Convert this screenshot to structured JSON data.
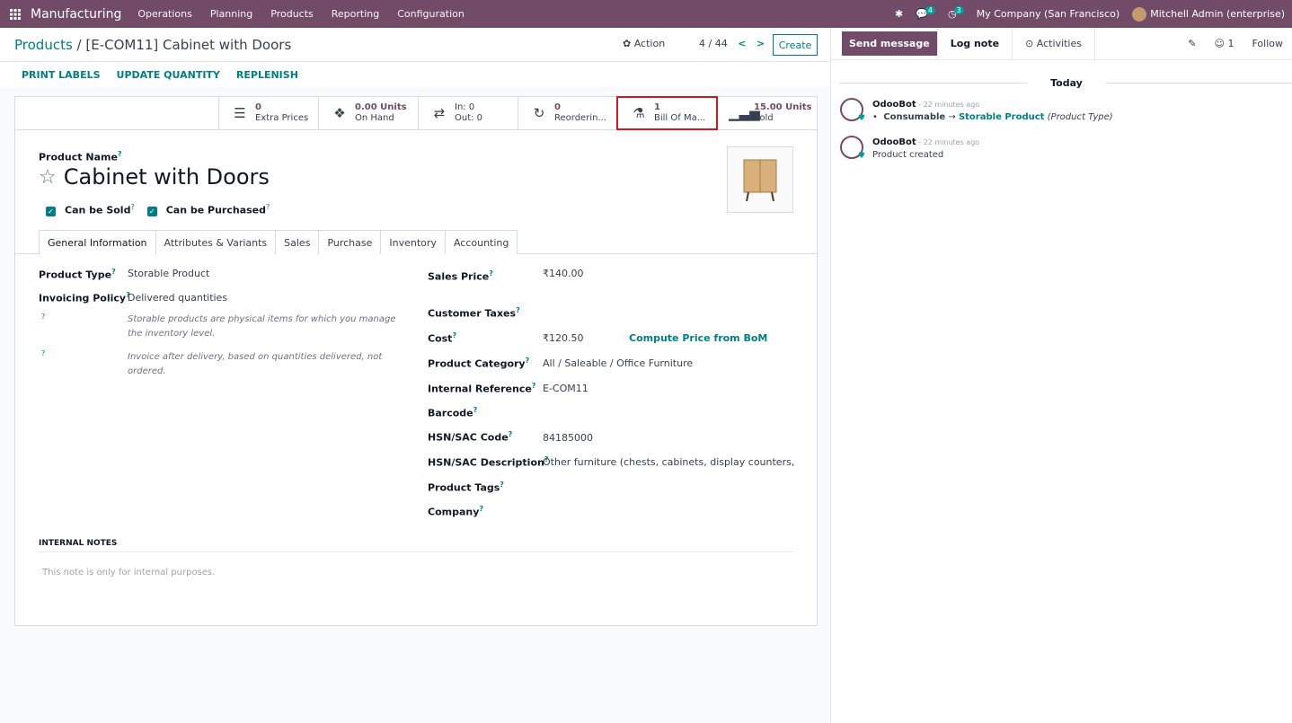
{
  "topbar": {
    "app_name": "Manufacturing",
    "menus": [
      "Operations",
      "Planning",
      "Products",
      "Reporting",
      "Configuration"
    ],
    "messages_count": "4",
    "activities_count": "3",
    "company": "My Company (San Francisco)",
    "user": "Mitchell Admin (enterprise)"
  },
  "breadcrumb": {
    "parent": "Products",
    "sep": " / ",
    "current": "[E-COM11] Cabinet with Doors"
  },
  "controlbar": {
    "action_label": "✿ Action",
    "pager": "4 / 44",
    "create_label": "Create"
  },
  "statusbar": {
    "buttons": [
      "PRINT LABELS",
      "UPDATE QUANTITY",
      "REPLENISH"
    ]
  },
  "stats": [
    {
      "num": "0",
      "label": "Extra Prices",
      "icon": "list-icon"
    },
    {
      "num": "0.00 Units",
      "label": "On Hand",
      "icon": "cubes-icon"
    },
    {
      "num": "In:   0",
      "label": "Out:  0",
      "icon": "arrows-icon"
    },
    {
      "num": "0",
      "label": "Reorderin...",
      "icon": "refresh-icon"
    },
    {
      "num": "1",
      "label": "Bill Of Ma...",
      "icon": "flask-icon"
    },
    {
      "num": "15.00 Units",
      "label": "Sold",
      "icon": "signal-icon"
    }
  ],
  "product": {
    "name_label": "Product Name",
    "name": "Cabinet with Doors",
    "can_be_sold": "Can be Sold",
    "can_be_purchased": "Can be Purchased"
  },
  "tabs": [
    "General Information",
    "Attributes & Variants",
    "Sales",
    "Purchase",
    "Inventory",
    "Accounting"
  ],
  "left_fields": {
    "product_type_label": "Product Type",
    "product_type": "Storable Product",
    "invoicing_policy_label": "Invoicing Policy",
    "invoicing_policy": "Delivered quantities",
    "hint1": "Storable products are physical items for which you manage the inventory level.",
    "hint2": "Invoice after delivery, based on quantities delivered, not ordered."
  },
  "right_fields": {
    "sales_price_label": "Sales Price",
    "sales_price": "₹140.00",
    "customer_taxes_label": "Customer Taxes",
    "cost_label": "Cost",
    "cost": "₹120.50",
    "compute_label": "Compute Price from BoM",
    "category_label": "Product Category",
    "category": "All / Saleable / Office Furniture",
    "ref_label": "Internal Reference",
    "ref": "E-COM11",
    "barcode_label": "Barcode",
    "hsn_code_label": "HSN/SAC Code",
    "hsn_code": "84185000",
    "hsn_desc_label": "HSN/SAC Description",
    "hsn_desc": "Other furniture (chests, cabinets, display counters, show-c",
    "tags_label": "Product Tags",
    "company_label": "Company"
  },
  "notes": {
    "header": "INTERNAL NOTES",
    "placeholder": "This note is only for internal purposes."
  },
  "chatter": {
    "send_message": "Send message",
    "log_note": "Log note",
    "activities": "⊙ Activities",
    "followers_count": "1",
    "follow": "Follow",
    "today": "Today",
    "messages": [
      {
        "author": "OdooBot",
        "time": " - 22 minutes ago",
        "old": "Consumable",
        "arrow": " → ",
        "new": "Storable Product",
        "field": " (Product Type)"
      },
      {
        "author": "OdooBot",
        "time": " - 22 minutes ago",
        "body": "Product created"
      }
    ]
  },
  "colors": {
    "brand": "#714b67",
    "accent": "#017e84",
    "highlight": "#d11a1a"
  }
}
